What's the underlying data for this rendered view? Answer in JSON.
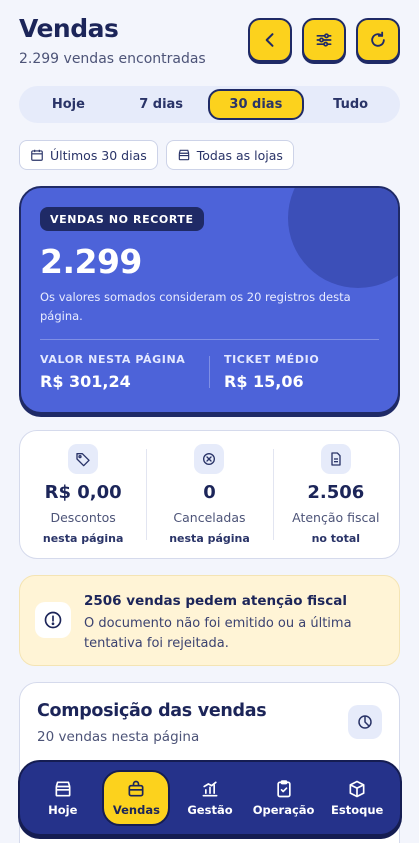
{
  "header": {
    "title": "Vendas",
    "subtitle": "2.299 vendas encontradas",
    "buttons": [
      "back-icon",
      "filters-icon",
      "refresh-icon"
    ]
  },
  "period_tabs": [
    {
      "label": "Hoje",
      "active": false
    },
    {
      "label": "7 dias",
      "active": false
    },
    {
      "label": "30 dias",
      "active": true
    },
    {
      "label": "Tudo",
      "active": false
    }
  ],
  "filters": {
    "period": "Últimos 30 dias",
    "store": "Todas as lojas"
  },
  "summary": {
    "badge": "VENDAS NO RECORTE",
    "count": "2.299",
    "description": "Os valores somados consideram os 20 registros desta página.",
    "page_value_label": "VALOR NESTA PÁGINA",
    "page_value": "R$ 301,24",
    "ticket_label": "TICKET MÉDIO",
    "ticket_value": "R$ 15,06"
  },
  "stats": [
    {
      "icon": "tag-icon",
      "value": "R$ 0,00",
      "label": "Descontos",
      "sub": "nesta página"
    },
    {
      "icon": "cancel-icon",
      "value": "0",
      "label": "Canceladas",
      "sub": "nesta página"
    },
    {
      "icon": "document-icon",
      "value": "2.506",
      "label": "Atenção fiscal",
      "sub": "no total"
    }
  ],
  "alert": {
    "title": "2506 vendas pedem atenção fiscal",
    "text": "O documento não foi emitido ou a última tentativa foi rejeitada."
  },
  "composition": {
    "title": "Composição das vendas",
    "subtitle": "20 vendas nesta página"
  },
  "nav": [
    {
      "label": "Hoje",
      "icon": "store-icon",
      "active": false
    },
    {
      "label": "Vendas",
      "icon": "bag-icon",
      "active": true
    },
    {
      "label": "Gestão",
      "icon": "chart-icon",
      "active": false
    },
    {
      "label": "Operação",
      "icon": "clipboard-icon",
      "active": false
    },
    {
      "label": "Estoque",
      "icon": "box-icon",
      "active": false
    }
  ],
  "colors": {
    "accent": "#fcd21d",
    "primary": "#4d63d9",
    "navy": "#1f2a66",
    "nav_bg": "#25328a",
    "alert_bg": "#fff4d6"
  }
}
